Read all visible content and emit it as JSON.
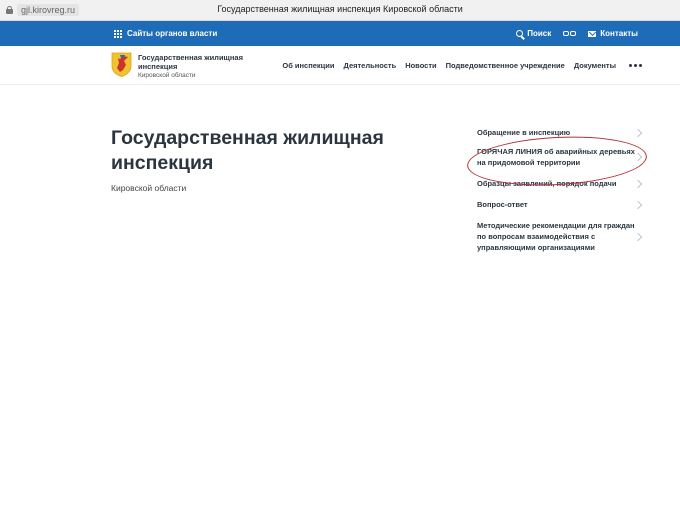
{
  "browser": {
    "url": "gjl.kirovreg.ru",
    "tab_title": "Государственная жилищная инспекция Кировской области"
  },
  "topbar": {
    "sites_label": "Сайты органов власти",
    "search_label": "Поиск",
    "contacts_label": "Контакты",
    "accessibility_icon": "glasses-icon"
  },
  "header": {
    "org_name": "Государственная жилищная инспекция",
    "org_region": "Кировской области",
    "nav": [
      {
        "label": "Об инспекции"
      },
      {
        "label": "Деятельность"
      },
      {
        "label": "Новости"
      },
      {
        "label": "Подведомственное учреждение"
      },
      {
        "label": "Документы"
      }
    ]
  },
  "main": {
    "title": "Государственная жилищная инспекция",
    "subtitle": "Кировской области"
  },
  "side_menu": [
    {
      "label": "Обращение в инспекцию"
    },
    {
      "label": "ГОРЯЧАЯ ЛИНИЯ об аварийных деревьях на придомовой территории"
    },
    {
      "label": "Образцы заявлений, порядок подачи"
    },
    {
      "label": "Вопрос-ответ"
    },
    {
      "label": "Методические рекомендации для граждан по вопросам взаимодействия с управляющими организациями"
    }
  ],
  "colors": {
    "brand_blue": "#1e6cb8",
    "highlight_red": "#b2323a",
    "text_dark": "#2b3540"
  }
}
